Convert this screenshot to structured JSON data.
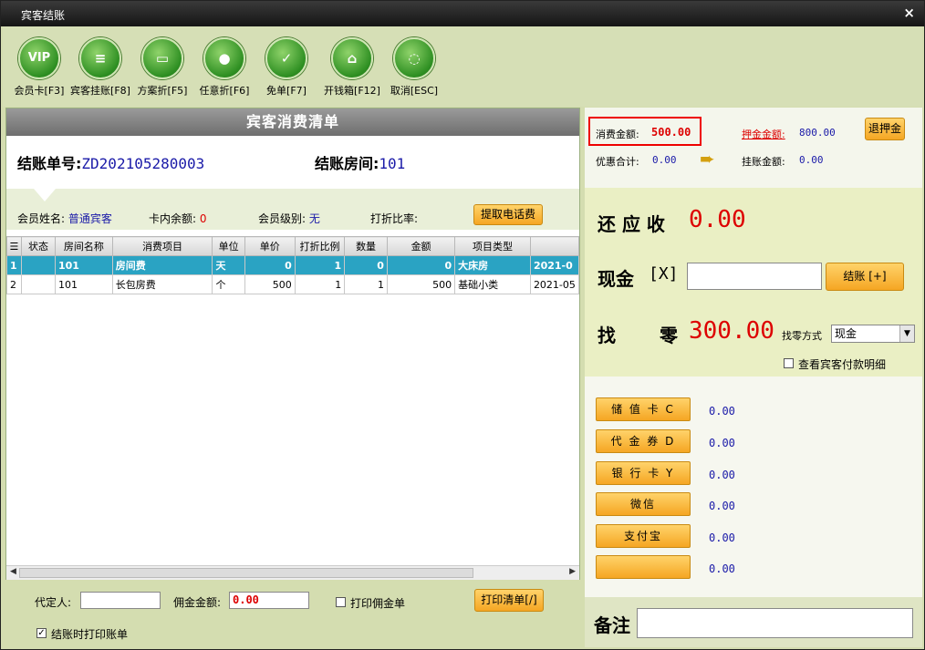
{
  "window": {
    "title": "宾客结账",
    "close": "×"
  },
  "toolbar": [
    {
      "icon": "vip-icon",
      "glyph": "VIP",
      "label": "会员卡[F3]"
    },
    {
      "icon": "guest-ledger-icon",
      "glyph": "≡",
      "label": "宾客挂账[F8]"
    },
    {
      "icon": "plan-discount-icon",
      "glyph": "▭",
      "label": "方案折[F5]"
    },
    {
      "icon": "any-discount-icon",
      "glyph": "●",
      "label": "任意折[F6]"
    },
    {
      "icon": "free-bill-icon",
      "glyph": "✓",
      "label": "免单[F7]"
    },
    {
      "icon": "cash-drawer-icon",
      "glyph": "⌂",
      "label": "开钱箱[F12]"
    },
    {
      "icon": "cancel-icon",
      "glyph": "◌",
      "label": "取消[ESC]"
    }
  ],
  "list": {
    "title": "宾客消费清单",
    "bill_no_label": "结账单号:",
    "bill_no": "ZD202105280003",
    "room_label": "结账房间:",
    "room": "101"
  },
  "member": {
    "name_label": "会员姓名:",
    "name": "普通宾客",
    "balance_label": "卡内余额:",
    "balance": "0",
    "level_label": "会员级别:",
    "level": "无",
    "discount_label": "打折比率:",
    "phone_fee_button": "提取电话费"
  },
  "table": {
    "headers": [
      "☰",
      "状态",
      "房间名称",
      "消费项目",
      "单位",
      "单价",
      "打折比例",
      "数量",
      "金额",
      "项目类型",
      ""
    ],
    "rows": [
      [
        "1",
        "",
        "101",
        "房间费",
        "天",
        "0",
        "1",
        "0",
        "0",
        "大床房",
        "2021-0"
      ],
      [
        "2",
        "",
        "101",
        "长包房费",
        "个",
        "500",
        "1",
        "1",
        "500",
        "基础小类",
        "2021-05"
      ]
    ]
  },
  "bottom": {
    "agent_label": "代定人:",
    "commission_label": "佣金金额:",
    "commission_value": "0.00",
    "print_commission_label": "打印佣金单",
    "print_list_button": "打印清单[/]",
    "print_on_checkout_label": "结账时打印账单"
  },
  "summary": {
    "consume_label": "消费金额:",
    "consume_value": "500.00",
    "deposit_label": "押金金额:",
    "deposit_value": "800.00",
    "refund_deposit_button": "退押金",
    "discount_total_label": "优惠合计:",
    "discount_total_value": "0.00",
    "ledger_label": "挂账金额:",
    "ledger_value": "0.00"
  },
  "settle": {
    "receivable_label": "还 应 收",
    "receivable_value": "0.00",
    "cash_label": "现金",
    "cash_key": "[X]",
    "checkout_button": "结账 [+]",
    "change_label_1": "找",
    "change_label_2": "零",
    "change_value": "300.00",
    "change_method_label": "找零方式",
    "change_method_value": "现金",
    "view_detail_label": "查看宾客付款明细"
  },
  "payments": [
    {
      "label": "储 值 卡 C",
      "value": "0.00"
    },
    {
      "label": "代 金 券 D",
      "value": "0.00"
    },
    {
      "label": "银 行 卡 Y",
      "value": "0.00"
    },
    {
      "label": "微信",
      "value": "0.00"
    },
    {
      "label": "支付宝",
      "value": "0.00"
    },
    {
      "label": "",
      "value": "0.00"
    }
  ],
  "note": {
    "label": "备注"
  },
  "colors": {
    "accent_red": "#dd0000",
    "value_blue": "#1a1aa8",
    "selected_row": "#2aa3c3",
    "button_orange": "#f5a623"
  }
}
